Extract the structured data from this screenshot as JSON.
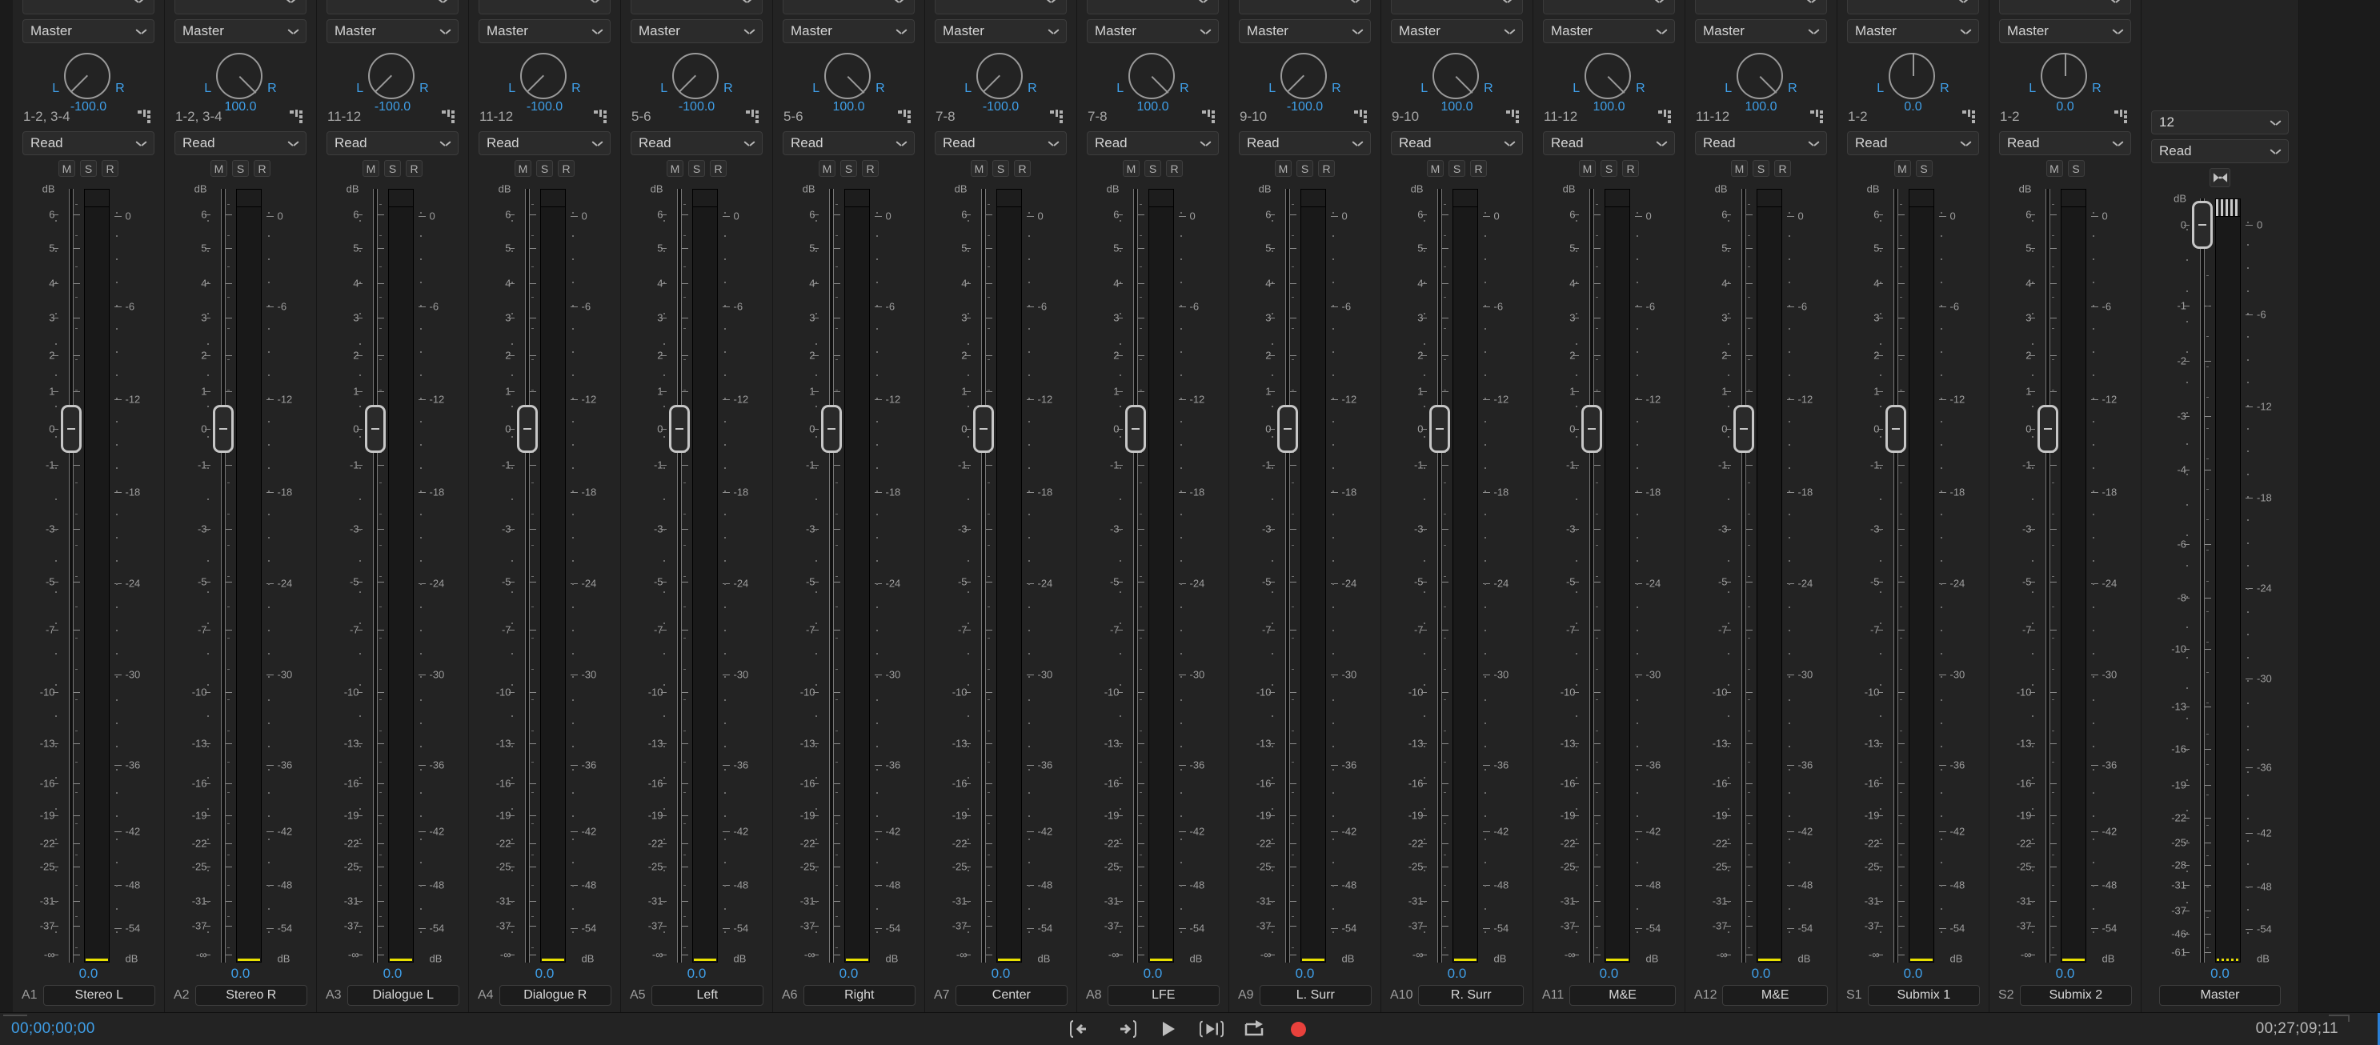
{
  "accent_blue": "#3f9fe8",
  "meter_peak_yellow": "#e8e000",
  "record_red": "#e8413c",
  "strip_defaults": {
    "output_label": "Master",
    "automation_label": "Read",
    "pan_l": "L",
    "pan_r": "R",
    "gain": "0.0",
    "db_unit": "dB",
    "mute_label": "M",
    "solo_label": "S",
    "record_label": "R",
    "routing_icon": "routing-icon",
    "chevron_icon": "chevron-down-icon"
  },
  "fader_scale": [
    "dB",
    "6",
    "5",
    "4",
    "3",
    "2",
    "1",
    "0",
    "-1",
    "-3",
    "-5",
    "-7",
    "-10",
    "-13",
    "-16",
    "-19",
    "-22",
    "-25",
    "-31",
    "-37",
    "-∞"
  ],
  "meter_scale": [
    "0",
    "-6",
    "-12",
    "-18",
    "-24",
    "-30",
    "-36",
    "-42",
    "-48",
    "-54",
    "dB"
  ],
  "master_fader_scale": [
    "dB",
    "0",
    "-1",
    "-2",
    "-3",
    "-4",
    "-6",
    "-8",
    "-10",
    "-13",
    "-16",
    "-19",
    "-22",
    "-25",
    "-28",
    "-31",
    "-37",
    "-46",
    "-61"
  ],
  "strips": [
    {
      "num": "A1",
      "name": "Stereo L",
      "output": "Master",
      "pan": "-100.0",
      "pan_angle": -135,
      "routing": "1-2, 3-4",
      "automation": "Read",
      "gain": "0.0",
      "has_record": true
    },
    {
      "num": "A2",
      "name": "Stereo R",
      "output": "Master",
      "pan": "100.0",
      "pan_angle": 135,
      "routing": "1-2, 3-4",
      "automation": "Read",
      "gain": "0.0",
      "has_record": true
    },
    {
      "num": "A3",
      "name": "Dialogue L",
      "output": "Master",
      "pan": "-100.0",
      "pan_angle": -135,
      "routing": "11-12",
      "automation": "Read",
      "gain": "0.0",
      "has_record": true
    },
    {
      "num": "A4",
      "name": "Dialogue R",
      "output": "Master",
      "pan": "-100.0",
      "pan_angle": -135,
      "routing": "11-12",
      "automation": "Read",
      "gain": "0.0",
      "has_record": true
    },
    {
      "num": "A5",
      "name": "Left",
      "output": "Master",
      "pan": "-100.0",
      "pan_angle": -135,
      "routing": "5-6",
      "automation": "Read",
      "gain": "0.0",
      "has_record": true
    },
    {
      "num": "A6",
      "name": "Right",
      "output": "Master",
      "pan": "100.0",
      "pan_angle": 135,
      "routing": "5-6",
      "automation": "Read",
      "gain": "0.0",
      "has_record": true
    },
    {
      "num": "A7",
      "name": "Center",
      "output": "Master",
      "pan": "-100.0",
      "pan_angle": -135,
      "routing": "7-8",
      "automation": "Read",
      "gain": "0.0",
      "has_record": true
    },
    {
      "num": "A8",
      "name": "LFE",
      "output": "Master",
      "pan": "100.0",
      "pan_angle": 135,
      "routing": "7-8",
      "automation": "Read",
      "gain": "0.0",
      "has_record": true
    },
    {
      "num": "A9",
      "name": "L. Surr",
      "output": "Master",
      "pan": "-100.0",
      "pan_angle": -135,
      "routing": "9-10",
      "automation": "Read",
      "gain": "0.0",
      "has_record": true
    },
    {
      "num": "A10",
      "name": "R. Surr",
      "output": "Master",
      "pan": "100.0",
      "pan_angle": 135,
      "routing": "9-10",
      "automation": "Read",
      "gain": "0.0",
      "has_record": true
    },
    {
      "num": "A11",
      "name": "M&E",
      "output": "Master",
      "pan": "100.0",
      "pan_angle": 135,
      "routing": "11-12",
      "automation": "Read",
      "gain": "0.0",
      "has_record": true
    },
    {
      "num": "A12",
      "name": "M&E",
      "output": "Master",
      "pan": "100.0",
      "pan_angle": 135,
      "routing": "11-12",
      "automation": "Read",
      "gain": "0.0",
      "has_record": true
    },
    {
      "num": "S1",
      "name": "Submix 1",
      "output": "Master",
      "pan": "0.0",
      "pan_angle": 0,
      "routing": "1-2",
      "automation": "Read",
      "gain": "0.0",
      "has_record": false
    },
    {
      "num": "S2",
      "name": "Submix 2",
      "output": "Master",
      "pan": "0.0",
      "pan_angle": 0,
      "routing": "1-2",
      "automation": "Read",
      "gain": "0.0",
      "has_record": false
    }
  ],
  "master": {
    "channel_count": "12",
    "automation": "Read",
    "name": "Master",
    "gain": "0.0",
    "db_unit": "dB",
    "bowtie_icon": "bowtie-icon"
  },
  "transport": {
    "timecode_left": "00;00;00;00",
    "timecode_right": "00;27;09;11",
    "buttons": [
      {
        "name": "loop-start-icon",
        "glyph": "prev-bracket"
      },
      {
        "name": "loop-end-icon",
        "glyph": "next-bracket"
      },
      {
        "name": "play-icon",
        "glyph": "play"
      },
      {
        "name": "next-marker-icon",
        "glyph": "marker-next"
      },
      {
        "name": "loop-icon",
        "glyph": "loop"
      },
      {
        "name": "record-icon",
        "glyph": "record"
      }
    ]
  }
}
